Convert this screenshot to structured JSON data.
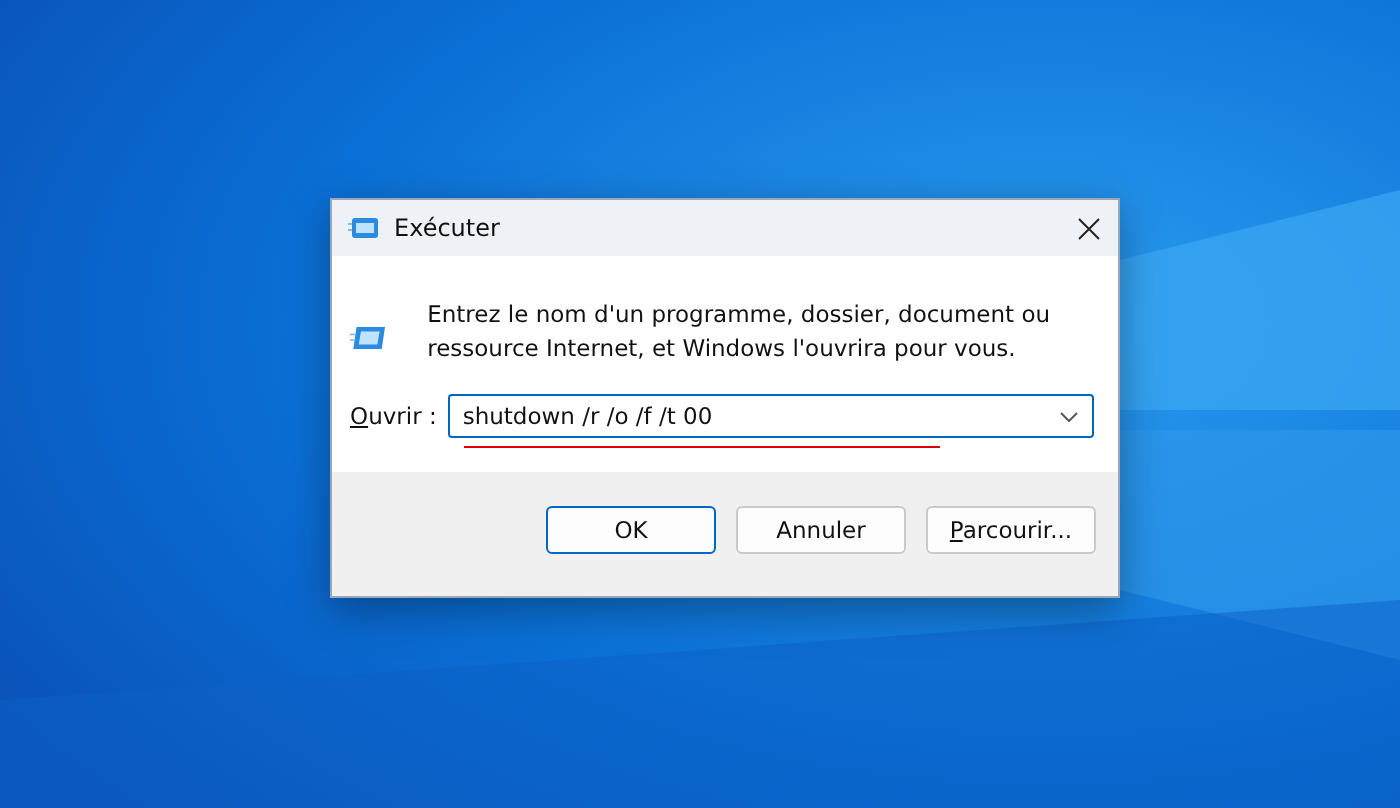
{
  "window": {
    "title": "Exécuter"
  },
  "prompt": "Entrez le nom d'un programme, dossier, document ou ressource Internet, et Windows l'ouvrira pour vous.",
  "open_field": {
    "label": {
      "access_key": "O",
      "rest": "uvrir :"
    },
    "value": "shutdown /r /o /f /t 00"
  },
  "buttons": [
    {
      "label": {
        "rest": "OK"
      },
      "default": true
    },
    {
      "label": {
        "rest": "Annuler"
      },
      "default": false
    },
    {
      "label": {
        "access_key": "P",
        "rest": "arcourir..."
      },
      "default": false
    }
  ]
}
